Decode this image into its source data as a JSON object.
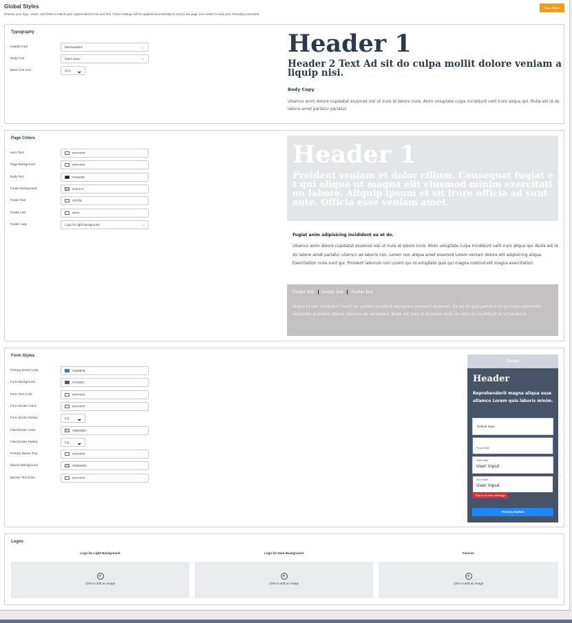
{
  "header": {
    "title": "Global Styles",
    "description": "Choose your logo, colors, and fonts to match your organization's look and feel. These settings will be applied automatically to every new page you create to keep your branding consistent.",
    "save_label": "Save Styles"
  },
  "typography": {
    "title": "Typography",
    "header_font_label": "Header Font",
    "header_font_value": "Merriweather",
    "body_font_label": "Body Font",
    "body_font_value": "Open Sans",
    "base_size_label": "Base Font Size",
    "base_size_value": "22 p",
    "preview": {
      "h1": "Header 1",
      "h2": "Header 2 Text Ad sit do culpa mollit dolore veniam aliquip nisi.",
      "body_copy_label": "Body Copy",
      "paragraph": "Ullamco anim dolore cupidatat eiusmod nisi ut irure id labore irure. Anim voluptate culpa incididunt velit irure aliqua qui. Nulla est id do labore amet pariatur pariatur."
    }
  },
  "page_colors": {
    "title": "Page Colors",
    "rows": [
      {
        "label": "Hero Text",
        "value": "#FFFFFF",
        "swatch": "#FFFFFF"
      },
      {
        "label": "Page Background",
        "value": "#FFFFFF",
        "swatch": "#FFFFFF"
      },
      {
        "label": "Body Text",
        "value": "#101828",
        "swatch": "#101828"
      },
      {
        "label": "Footer Background",
        "value": "#c3c1c1",
        "swatch": "#c3c1c1"
      },
      {
        "label": "Footer Text",
        "value": "#f7f7f6",
        "swatch": "#f7f7f6"
      },
      {
        "label": "Footer Link",
        "value": "#FFF",
        "swatch": "#FFFFFF"
      }
    ],
    "footer_logo_label": "Footer Logo",
    "footer_logo_value": "Logo for light background",
    "preview": {
      "hero_h1": "Header 1",
      "hero_text": "Proident veniam et dolor cillum. Consequat fugiat et qui aliqua ut magna elit eiusmod minim exercitation labore. Aliquip ipsum et sit irure officia ad sunt aute. Officia esse veniam amet.",
      "bold_line": "Fugiat anim adipisicing incididunt ea et do.",
      "paragraph": "Ullamco anim dolore cupidatat eiusmod nisi ut irure id labore irure. Anim voluptate culpa incididunt velit irure aliqua qui. Nulla est id do labore amet pariatur ullamco ad laboris non. Lorem non aliqua amet eiusmod Lorem veniam dolore elit adipisicing aliqua. Exercitation nulla sunt qui. Proident laborum non Lorem qui id voluptate quis qui magna nostrud elit magna exercitation.",
      "footer_links": [
        "Footer link",
        "Footer link",
        "Footer link"
      ],
      "footer_text": "Aliqua id non incididunt mollit eu veniam proident excepteur proident eiusmod. Ea ad sit quis pariatur ut qui aute commodo voluptate proident laboris laborum ex excepteur. Nulla est sunt id eiusmod dolor do duis do incididunt ut sit eiusmod."
    }
  },
  "form_styles": {
    "title": "Form Styles",
    "rows": [
      {
        "label": "Primary Brand Color",
        "value": "#1B88FB",
        "swatch": "#1B88FB",
        "type": "color"
      },
      {
        "label": "Form Background",
        "value": "#475467",
        "swatch": "#475467",
        "type": "color"
      },
      {
        "label": "Form Text Color",
        "value": "#FFFFFF",
        "swatch": "#FFFFFF",
        "type": "color"
      },
      {
        "label": "Form Border Color",
        "value": "#FFFFFF",
        "swatch": "#FFFFFF",
        "type": "color"
      },
      {
        "label": "Form Border Radius",
        "value": "0 p",
        "type": "select"
      },
      {
        "label": "Field Border Color",
        "value": "#D0D5DD",
        "swatch": "#D0D5DD",
        "type": "color"
      },
      {
        "label": "Field Border Radius",
        "value": "0 p",
        "type": "select"
      },
      {
        "label": "Primary Button Text",
        "value": "#FFFFFF",
        "swatch": "#FFFFFF",
        "type": "color"
      },
      {
        "label": "Banner Background",
        "value": "#D0D5DD",
        "swatch": "#D0D5DD",
        "type": "color"
      },
      {
        "label": "Banner Text Color",
        "value": "#FFFFFF",
        "swatch": "#FFFFFF",
        "type": "color"
      }
    ],
    "preview": {
      "banner": "Banner",
      "header": "Header",
      "text": "Reprehenderit magna aliqua esse ullamco Lorem quis laboris minim.",
      "default_state": "Default State",
      "focus_state": "Focus State",
      "filled_state": "Filled State",
      "filled_value": "User input",
      "error_state": "Error State",
      "error_value": "User input",
      "error_message": "This is an error message",
      "button": "Primary Button"
    }
  },
  "logos": {
    "title": "Logos",
    "slots": [
      {
        "label": "Logo for Light Background",
        "cta": "Click to add an image"
      },
      {
        "label": "Logo for Dark Background",
        "cta": "Click to add an image"
      },
      {
        "label": "Favicon",
        "cta": "Click to add an image"
      }
    ]
  }
}
